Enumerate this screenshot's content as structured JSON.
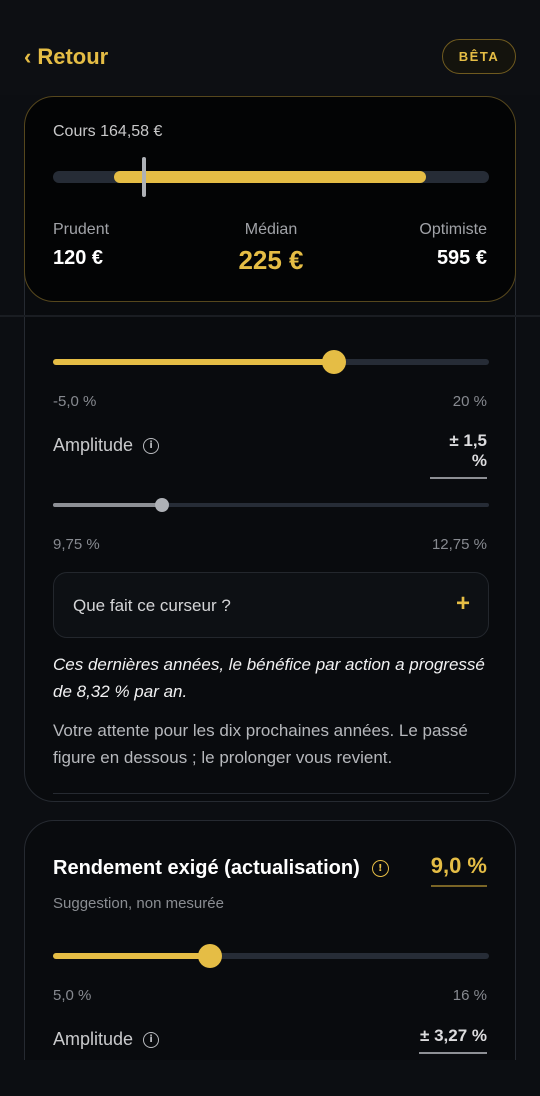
{
  "header": {
    "back_label": "Retour",
    "back_chevron": "‹",
    "badge": "BÊTA"
  },
  "summary": {
    "current_price": "Cours 164,58 €",
    "range_low_frac": 0.14,
    "range_high_frac": 0.855,
    "current_frac": 0.209,
    "prudent_label": "Prudent",
    "prudent_value": "120 €",
    "median_label": "Médian",
    "median_value": "225 €",
    "optimiste_label": "Optimiste",
    "optimiste_value": "595 €"
  },
  "growth": {
    "slider_value_frac": 0.645,
    "slider_min_label": "-5,0 %",
    "slider_max_label": "20 %",
    "amplitude_label": "Amplitude",
    "amplitude_value": "± 1,5 %",
    "amp_slider_frac": 0.25,
    "amp_min_label": "9,75 %",
    "amp_max_label": "12,75 %",
    "accordion_question": "Que fait ce curseur ?",
    "accordion_icon": "+",
    "note": "Ces dernières années, le bénéfice par action a progressé de 8,32 % par an.",
    "description": "Votre attente pour les dix prochaines années. Le passé figure en dessous ; le prolonger vous revient."
  },
  "discount": {
    "title": "Rendement exigé (actualisation)",
    "value": "9,0 %",
    "subtitle": "Suggestion, non mesurée",
    "slider_value_frac": 0.36,
    "min_label": "5,0 %",
    "max_label": "16 %",
    "amplitude_label": "Amplitude",
    "amplitude_value": "± 3,27 %"
  },
  "colors": {
    "accent": "#e5bd45",
    "track": "#262c36",
    "background": "#0c0e12"
  }
}
